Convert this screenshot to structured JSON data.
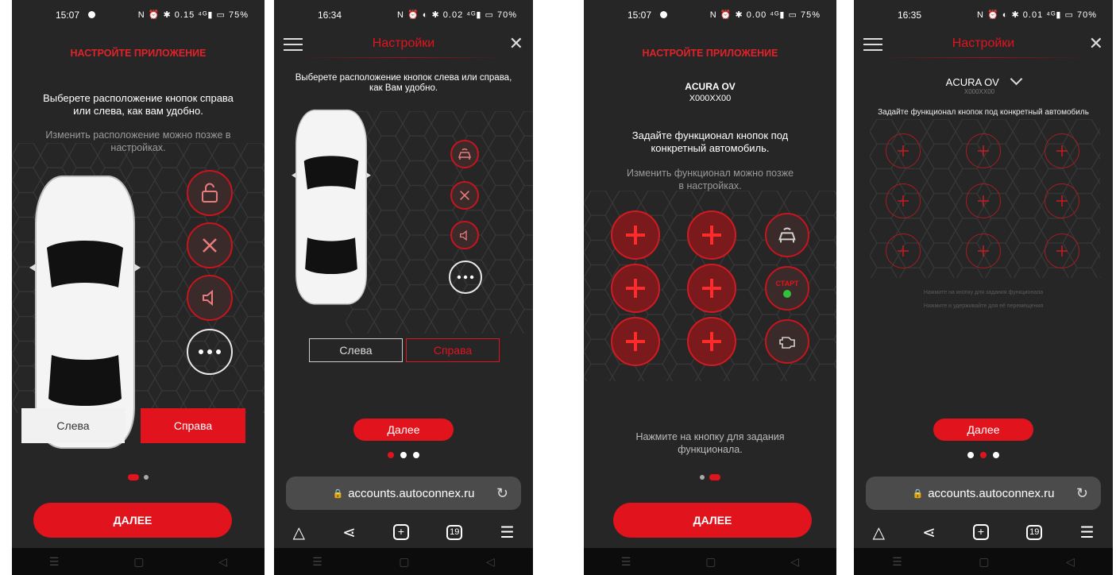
{
  "colors": {
    "accent": "#e1141d",
    "background": "#262626",
    "muted_text": "#9a9a9a"
  },
  "screen1": {
    "status": {
      "time": "15:07",
      "right": "N ⏰ ✱ 0.15 ⁴ᴳ▮ ▭ 75%"
    },
    "heading": "НАСТРОЙТЕ ПРИЛОЖЕНИЕ",
    "main_text": "Выберете расположение кнопок справа или слева, как вам удобно.",
    "sub_text": "Изменить расположение можно позже в настройках.",
    "side_icons": [
      "unlock-icon",
      "tools-icon",
      "horn-icon",
      "more-icon"
    ],
    "left_label": "Слева",
    "right_label": "Справа",
    "next_label": "ДАЛЕЕ"
  },
  "screen2": {
    "status": {
      "time": "16:34",
      "right": "N ⏰ ◐ ✱ 0.02 ⁴ᴳ▮ ▭ 70%"
    },
    "title": "Настройки",
    "main_text": "Выберете расположение кнопок слева или справа, как Вам удобно.",
    "side_icons": [
      "car-alarm-icon",
      "tools-icon",
      "horn-icon",
      "more-icon"
    ],
    "left_label": "Слева",
    "right_label": "Справа",
    "next_label": "Далее",
    "url": "accounts.autoconnex.ru",
    "tabs_count": "19"
  },
  "screen3": {
    "status": {
      "time": "15:07",
      "right": "N ⏰ ✱ 0.00 ⁴ᴳ▮ ▭ 75%"
    },
    "heading": "НАСТРОЙТЕ ПРИЛОЖЕНИЕ",
    "car_name": "ACURA OV",
    "plate": "X000XX00",
    "main_text": "Задайте функционал кнопок под конкретный автомобиль.",
    "sub_text": "Изменить функционал можно позже в настройках.",
    "start_label": "СТАРТ",
    "hint": "Нажмите на кнопку для задания функционала.",
    "next_label": "ДАЛЕЕ"
  },
  "screen4": {
    "status": {
      "time": "16:35",
      "right": "N ⏰ ◐ ✱ 0.01 ⁴ᴳ▮ ▭ 70%"
    },
    "title": "Настройки",
    "car_name": "ACURA OV",
    "plate": "X000XX00",
    "main_text": "Задайте функционал кнопок под конкретный автомобиль",
    "hint1": "Нажмите на кнопку для задания функционала",
    "hint2": "Нажмите и удерживайте для её перемещения",
    "next_label": "Далее",
    "url": "accounts.autoconnex.ru",
    "tabs_count": "19"
  }
}
